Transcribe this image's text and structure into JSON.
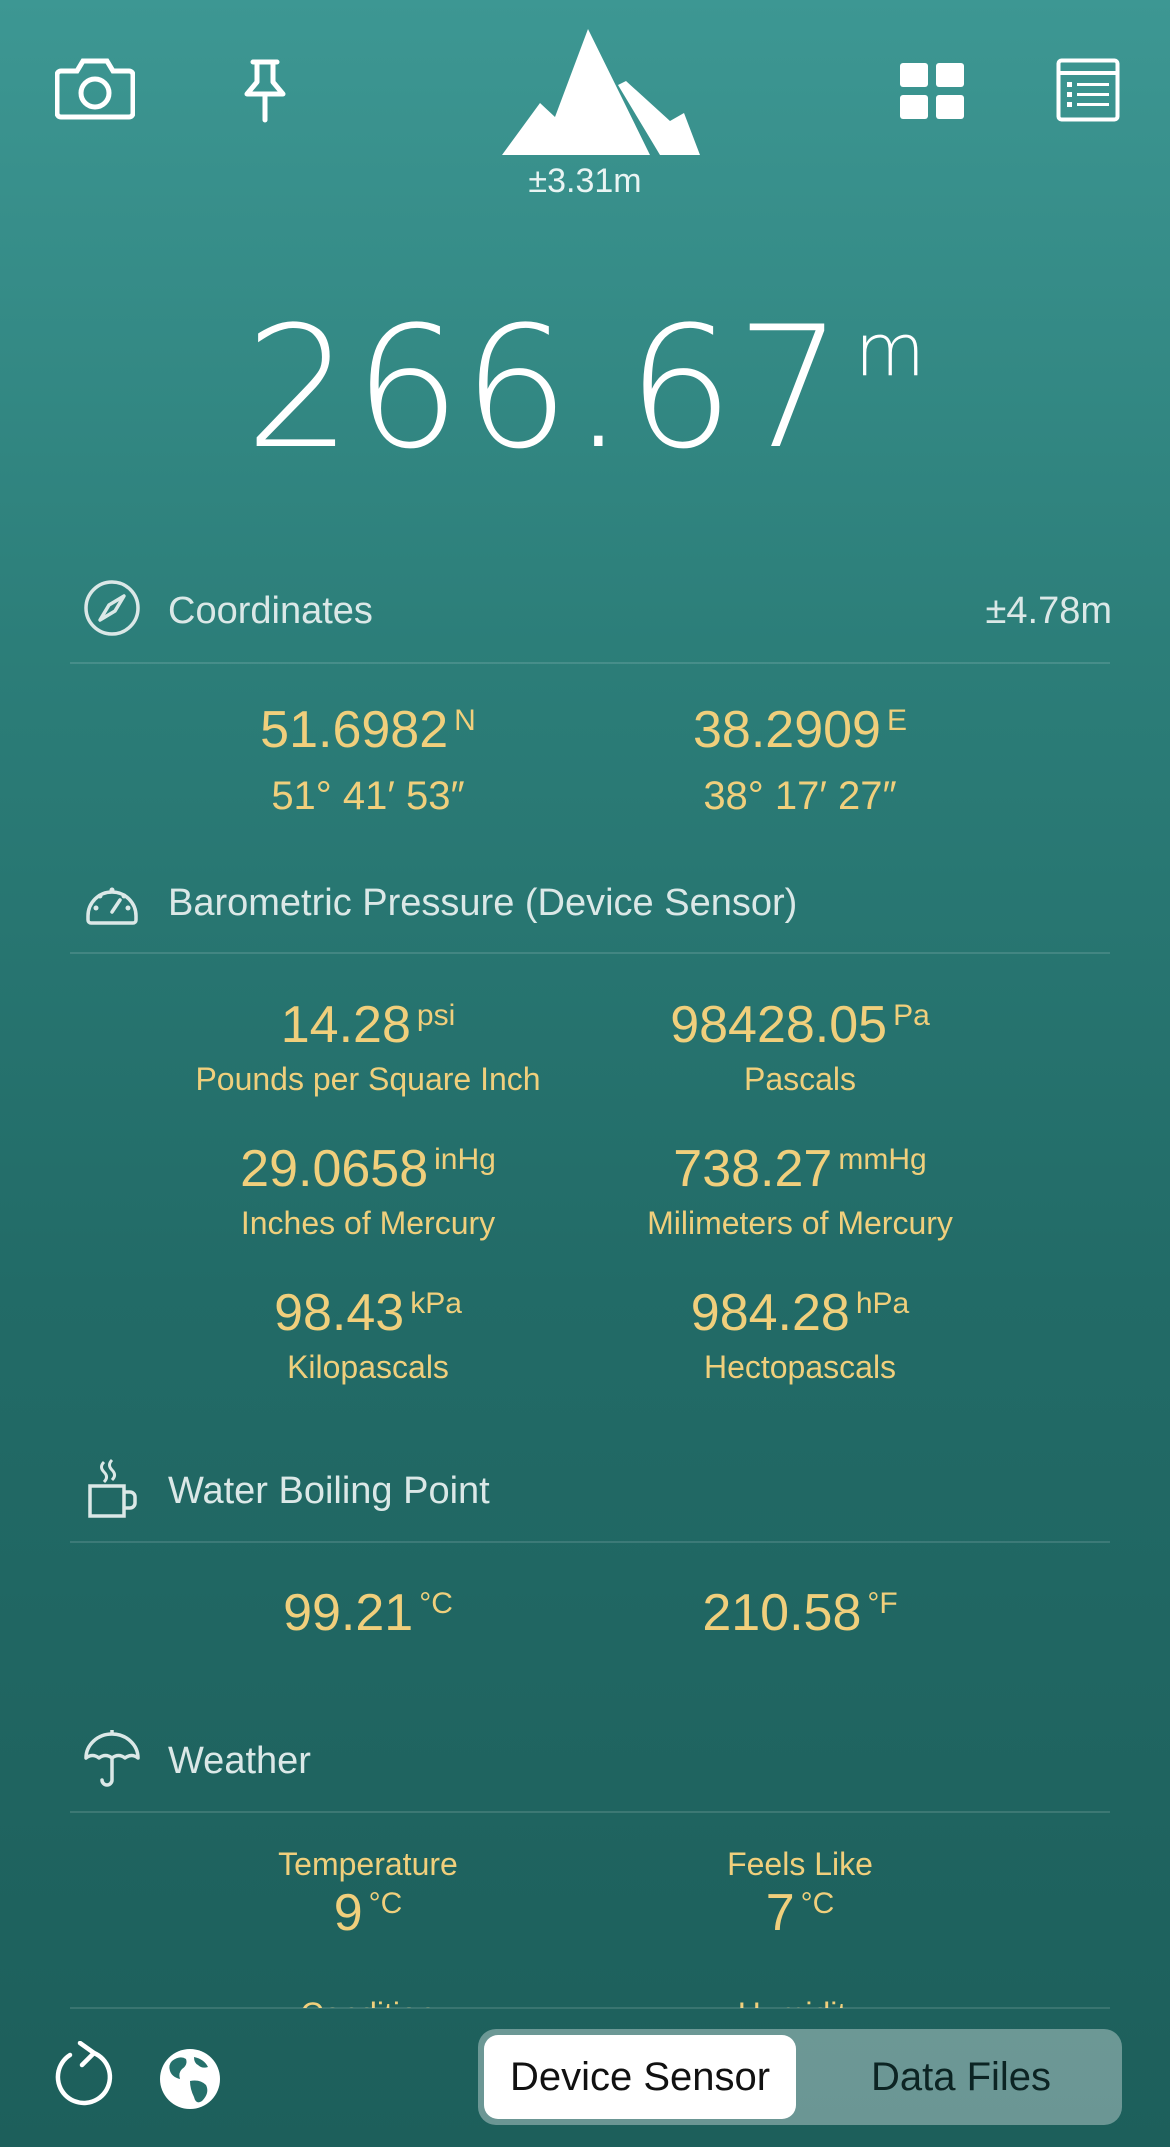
{
  "toolbar": {
    "accuracy": "±3.31m",
    "icons": [
      "camera-icon",
      "pin-icon",
      "mountain-icon",
      "grid-icon",
      "list-icon"
    ]
  },
  "altitude": {
    "value": "266.67",
    "unit": "m"
  },
  "coordinates": {
    "title": "Coordinates",
    "accuracy": "±4.78m",
    "lat": {
      "value": "51.6982",
      "dir": "N",
      "dms": "51° 41′ 53″"
    },
    "lon": {
      "value": "38.2909",
      "dir": "E",
      "dms": "38° 17′ 27″"
    }
  },
  "pressure": {
    "title": "Barometric Pressure (Device Sensor)",
    "psi": {
      "value": "14.28",
      "unit": "psi",
      "label": "Pounds per Square Inch"
    },
    "pa": {
      "value": "98428.05",
      "unit": "Pa",
      "label": "Pascals"
    },
    "inhg": {
      "value": "29.0658",
      "unit": "inHg",
      "label": "Inches of Mercury"
    },
    "mmhg": {
      "value": "738.27",
      "unit": "mmHg",
      "label": "Milimeters of Mercury"
    },
    "kpa": {
      "value": "98.43",
      "unit": "kPa",
      "label": "Kilopascals"
    },
    "hpa": {
      "value": "984.28",
      "unit": "hPa",
      "label": "Hectopascals"
    }
  },
  "boiling": {
    "title": "Water Boiling Point",
    "celsius": {
      "value": "99.21",
      "unit": "°C"
    },
    "fahrenheit": {
      "value": "210.58",
      "unit": "°F"
    }
  },
  "weather": {
    "title": "Weather",
    "temperature": {
      "label": "Temperature",
      "value": "9",
      "unit": "°C"
    },
    "feels_like": {
      "label": "Feels Like",
      "value": "7",
      "unit": "°C"
    },
    "condition_label": "Condition",
    "humidity_label": "Humidity"
  },
  "bottom": {
    "segments": [
      "Device Sensor",
      "Data Files"
    ],
    "active_segment": "Device Sensor"
  },
  "colors": {
    "accent": "#f0cf7c",
    "background_top": "#3d9793",
    "background_bottom": "#1d5f5b"
  }
}
